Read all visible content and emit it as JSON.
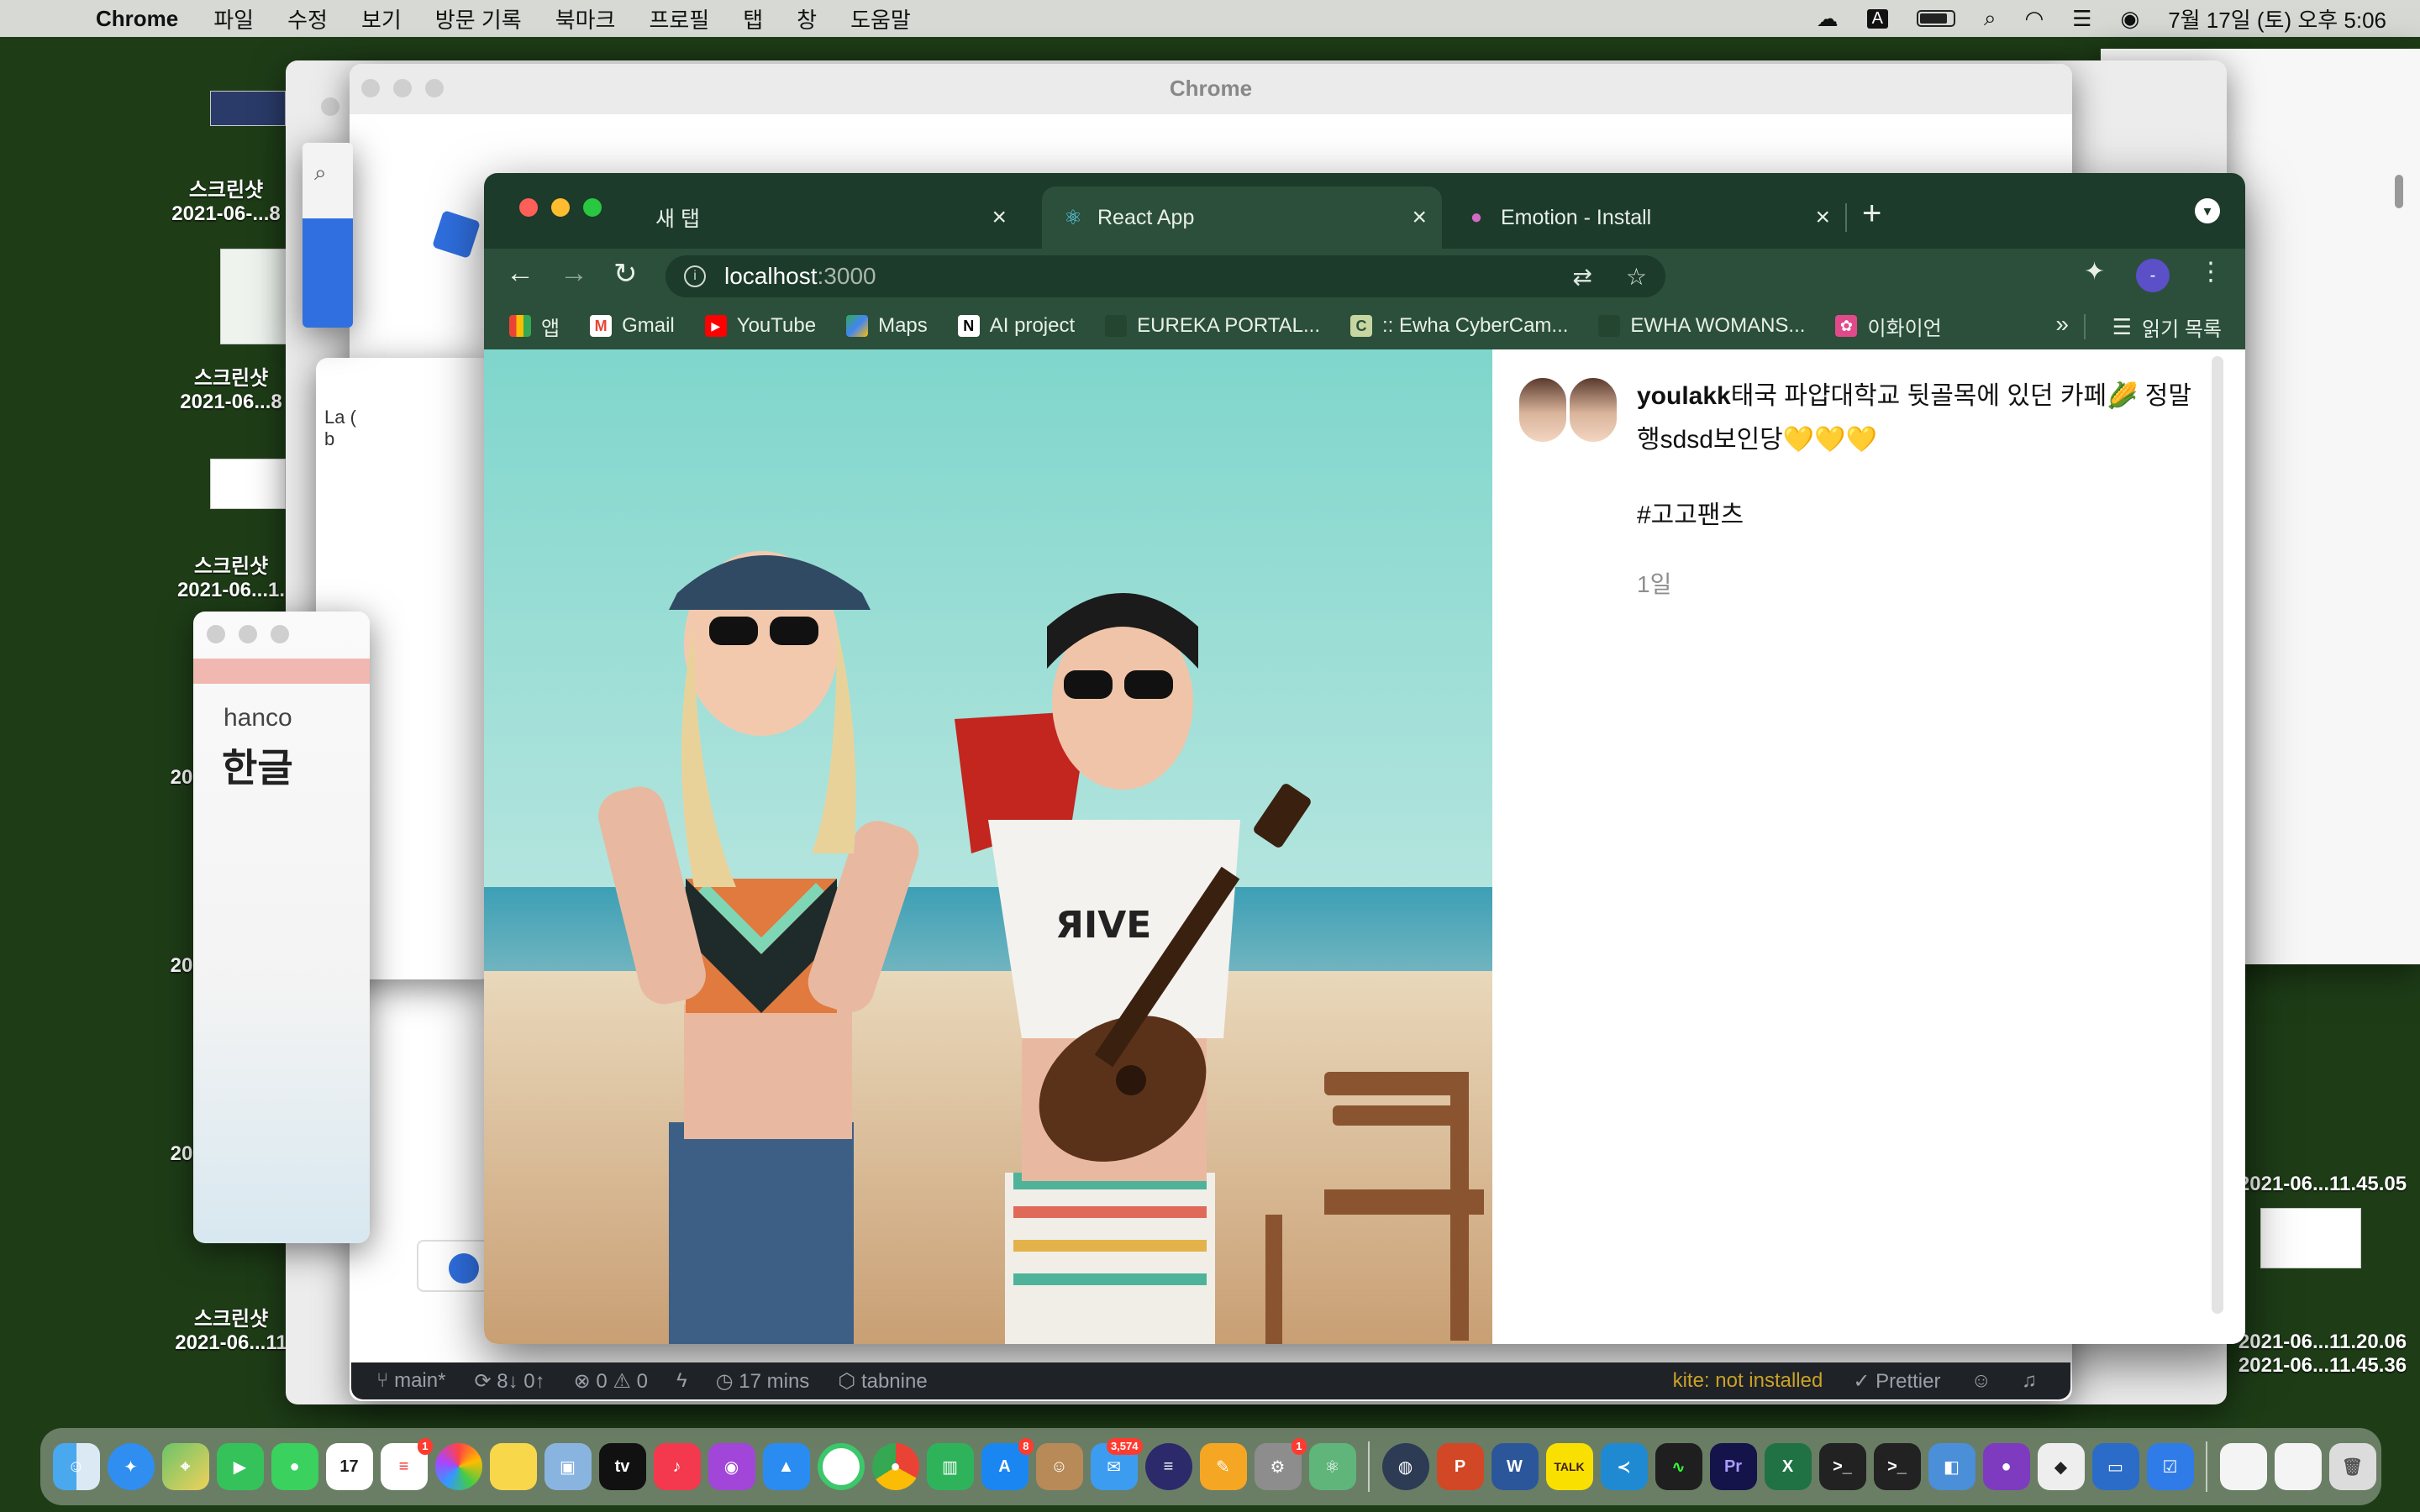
{
  "menubar": {
    "app": "Chrome",
    "items": [
      "파일",
      "수정",
      "보기",
      "방문 기록",
      "북마크",
      "프로필",
      "탭",
      "창",
      "도움말"
    ],
    "input_source": "A",
    "datetime": "7월 17일 (토) 오후 5:06"
  },
  "desktop": {
    "items": [
      {
        "name": "스크린샷",
        "date": "2021-06-...8"
      },
      {
        "name": "스크린샷",
        "date": "2021-06...8"
      },
      {
        "name": "스크린샷",
        "date": "2021-06...1."
      },
      {
        "name": "20",
        "date": ""
      },
      {
        "name": "20",
        "date": ""
      },
      {
        "name": "20",
        "date": ""
      },
      {
        "name": "스크린샷",
        "date": "2021-06...11"
      }
    ],
    "right_items": [
      {
        "name": "2021-06...11.45.05"
      },
      {
        "name": "2021-06...11.20.06"
      },
      {
        "name": "2021-06...11.45.36"
      }
    ]
  },
  "bg_window": {
    "title": "Chrome",
    "hancom_brand": "hanco",
    "hancom_title": "한글",
    "small_text": "La ( b"
  },
  "chrome": {
    "tabs": [
      {
        "label": "새 탭",
        "active": false
      },
      {
        "label": "React App",
        "active": true
      },
      {
        "label": "Emotion - Install",
        "active": false
      }
    ],
    "new_tab": "+",
    "address": {
      "host": "localhost",
      "port": ":3000"
    },
    "bookmarks": [
      {
        "label": "앱",
        "icon": "apps-grid-icon"
      },
      {
        "label": "Gmail",
        "icon": "gmail-icon"
      },
      {
        "label": "YouTube",
        "icon": "youtube-icon"
      },
      {
        "label": "Maps",
        "icon": "maps-icon"
      },
      {
        "label": "AI project",
        "icon": "notion-icon"
      },
      {
        "label": "EUREKA PORTAL...",
        "icon": "eureka-icon"
      },
      {
        "label": ":: Ewha CyberCam...",
        "icon": "cybercampus-icon"
      },
      {
        "label": "EWHA WOMANS...",
        "icon": "ewha-icon"
      },
      {
        "label": "이화이언",
        "icon": "ewhaian-icon"
      }
    ],
    "bookmarks_more": "»",
    "reading_list": "읽기 목록",
    "profile_initial": "-"
  },
  "post": {
    "username": "youlakk",
    "caption": "태국 파얍대학교 뒷골목에 있던 카페🌽 정말 행sdsd보인당💛💛💛",
    "hashtag": "#고고팬츠",
    "time": "1일"
  },
  "statusbar": {
    "branch": "main*",
    "sync": "8↓ 0↑",
    "errors": "0",
    "warnings": "0",
    "time": "17 mins",
    "tabnine": "tabnine",
    "kite": "kite: not installed",
    "prettier": "Prettier"
  },
  "dock": {
    "badges": {
      "calendar": "17",
      "reminders": "1",
      "appstore": "8",
      "mail": "3,574",
      "misc": "1"
    }
  },
  "colors": {
    "chrome_frame": "#1c3b2a",
    "chrome_toolbar": "#2b4f3a",
    "desktop": "#1e3d17",
    "profile": "#5b50c8"
  }
}
